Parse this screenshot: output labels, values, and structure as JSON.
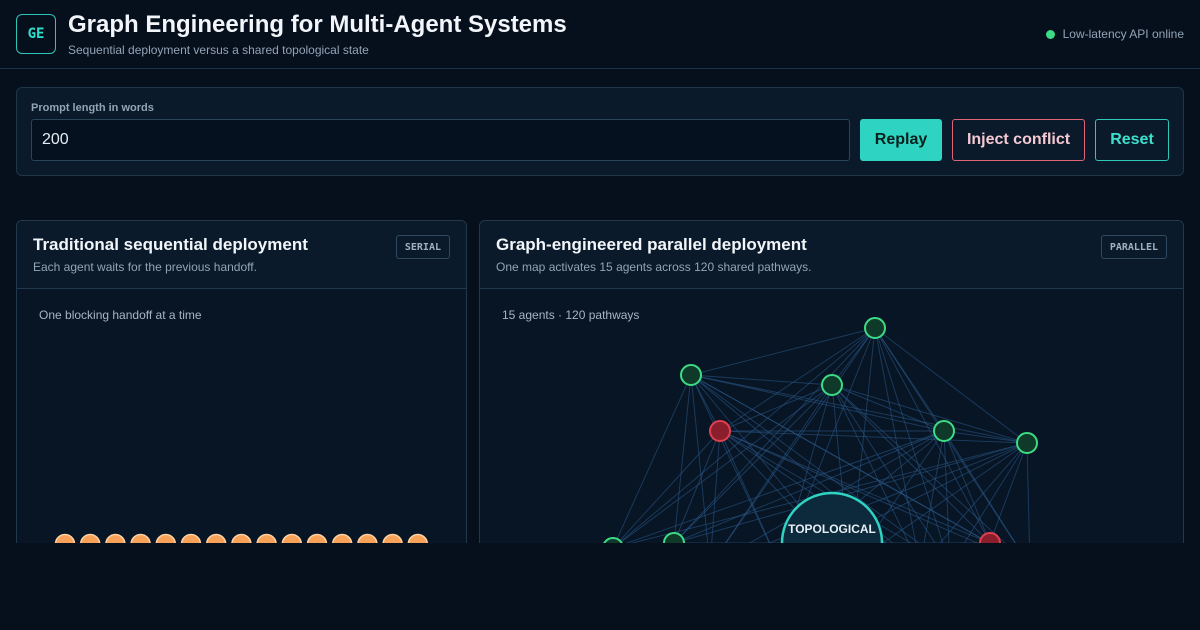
{
  "header": {
    "logo": "GE",
    "title": "Graph Engineering for Multi-Agent Systems",
    "subtitle": "Sequential deployment versus a shared topological state",
    "status": "Low-latency API online",
    "status_color": "#3ddc84"
  },
  "controls": {
    "prompt_label": "Prompt length in words",
    "prompt_value": "200",
    "replay_label": "Replay",
    "inject_label": "Inject conflict",
    "reset_label": "Reset"
  },
  "sequential": {
    "title": "Traditional sequential deployment",
    "description": "Each agent waits for the previous handoff.",
    "badge": "SERIAL",
    "caption": "One blocking handoff at a time",
    "agent_count": 15,
    "agent_color": "#f7a258"
  },
  "parallel": {
    "title": "Graph-engineered parallel deployment",
    "description": "One map activates 15 agents across 120 shared pathways.",
    "badge": "PARALLEL",
    "caption": "15 agents · 120 pathways",
    "hub_label": "TOPOLOGICAL",
    "agent_count": 15,
    "pathway_count": 120,
    "colors": {
      "active": "#3ddc84",
      "conflict": "#e0404e",
      "hub": "#2ed3c2",
      "edge": "#2b5a8a"
    }
  }
}
